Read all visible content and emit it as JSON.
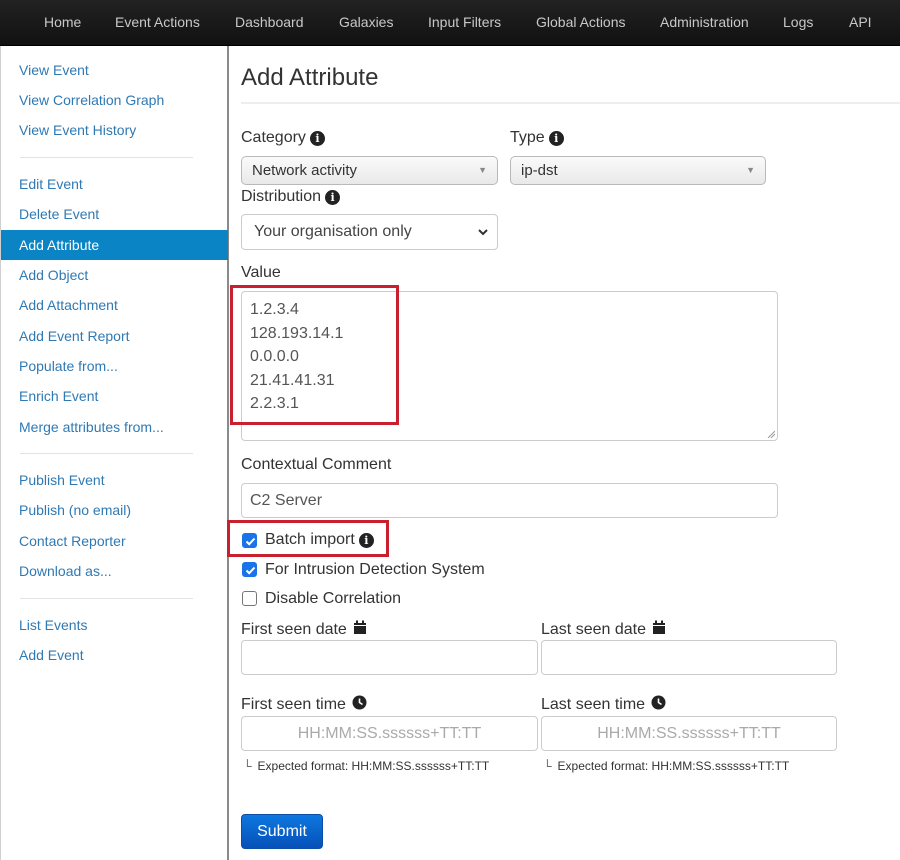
{
  "topnav": {
    "items": [
      {
        "label": "Home"
      },
      {
        "label": "Event Actions"
      },
      {
        "label": "Dashboard"
      },
      {
        "label": "Galaxies"
      },
      {
        "label": "Input Filters"
      },
      {
        "label": "Global Actions"
      },
      {
        "label": "Administration"
      },
      {
        "label": "Logs"
      },
      {
        "label": "API"
      }
    ]
  },
  "sidebar": {
    "groups": [
      [
        {
          "label": "View Event"
        },
        {
          "label": "View Correlation Graph"
        },
        {
          "label": "View Event History"
        }
      ],
      [
        {
          "label": "Edit Event"
        },
        {
          "label": "Delete Event"
        },
        {
          "label": "Add Attribute",
          "active": true
        },
        {
          "label": "Add Object"
        },
        {
          "label": "Add Attachment"
        },
        {
          "label": "Add Event Report"
        },
        {
          "label": "Populate from..."
        },
        {
          "label": "Enrich Event"
        },
        {
          "label": "Merge attributes from..."
        }
      ],
      [
        {
          "label": "Publish Event"
        },
        {
          "label": "Publish (no email)"
        },
        {
          "label": "Contact Reporter"
        },
        {
          "label": "Download as..."
        }
      ],
      [
        {
          "label": "List Events"
        },
        {
          "label": "Add Event"
        }
      ]
    ],
    "active_color": "#0b84c6",
    "link_color": "#2f79b3"
  },
  "form": {
    "title": "Add Attribute",
    "category": {
      "label": "Category",
      "value": "Network activity",
      "icon": "info-icon"
    },
    "type": {
      "label": "Type",
      "value": "ip-dst",
      "icon": "info-icon"
    },
    "distribution": {
      "label": "Distribution",
      "value": "Your organisation only",
      "icon": "info-icon"
    },
    "value": {
      "label": "Value",
      "lines": [
        "1.2.3.4",
        "128.193.14.1",
        "0.0.0.0",
        "21.41.41.31",
        "2.2.3.1"
      ]
    },
    "comment": {
      "label": "Contextual Comment",
      "value": "C2 Server"
    },
    "batch_import": {
      "label": "Batch import",
      "checked": true,
      "icon": "info-icon"
    },
    "ids": {
      "label": "For Intrusion Detection System",
      "checked": true
    },
    "disable_correlation": {
      "label": "Disable Correlation",
      "checked": false
    },
    "first_seen_date": {
      "label": "First seen date",
      "value": "",
      "icon": "calendar-icon"
    },
    "last_seen_date": {
      "label": "Last seen date",
      "value": "",
      "icon": "calendar-icon"
    },
    "first_seen_time": {
      "label": "First seen time",
      "placeholder": "HH:MM:SS.ssssss+TT:TT",
      "hint": "Expected format: HH:MM:SS.ssssss+TT:TT",
      "icon": "clock-icon"
    },
    "last_seen_time": {
      "label": "Last seen time",
      "placeholder": "HH:MM:SS.ssssss+TT:TT",
      "hint": "Expected format: HH:MM:SS.ssssss+TT:TT",
      "icon": "clock-icon"
    },
    "submit_label": "Submit",
    "highlight_color": "#c8202f"
  }
}
